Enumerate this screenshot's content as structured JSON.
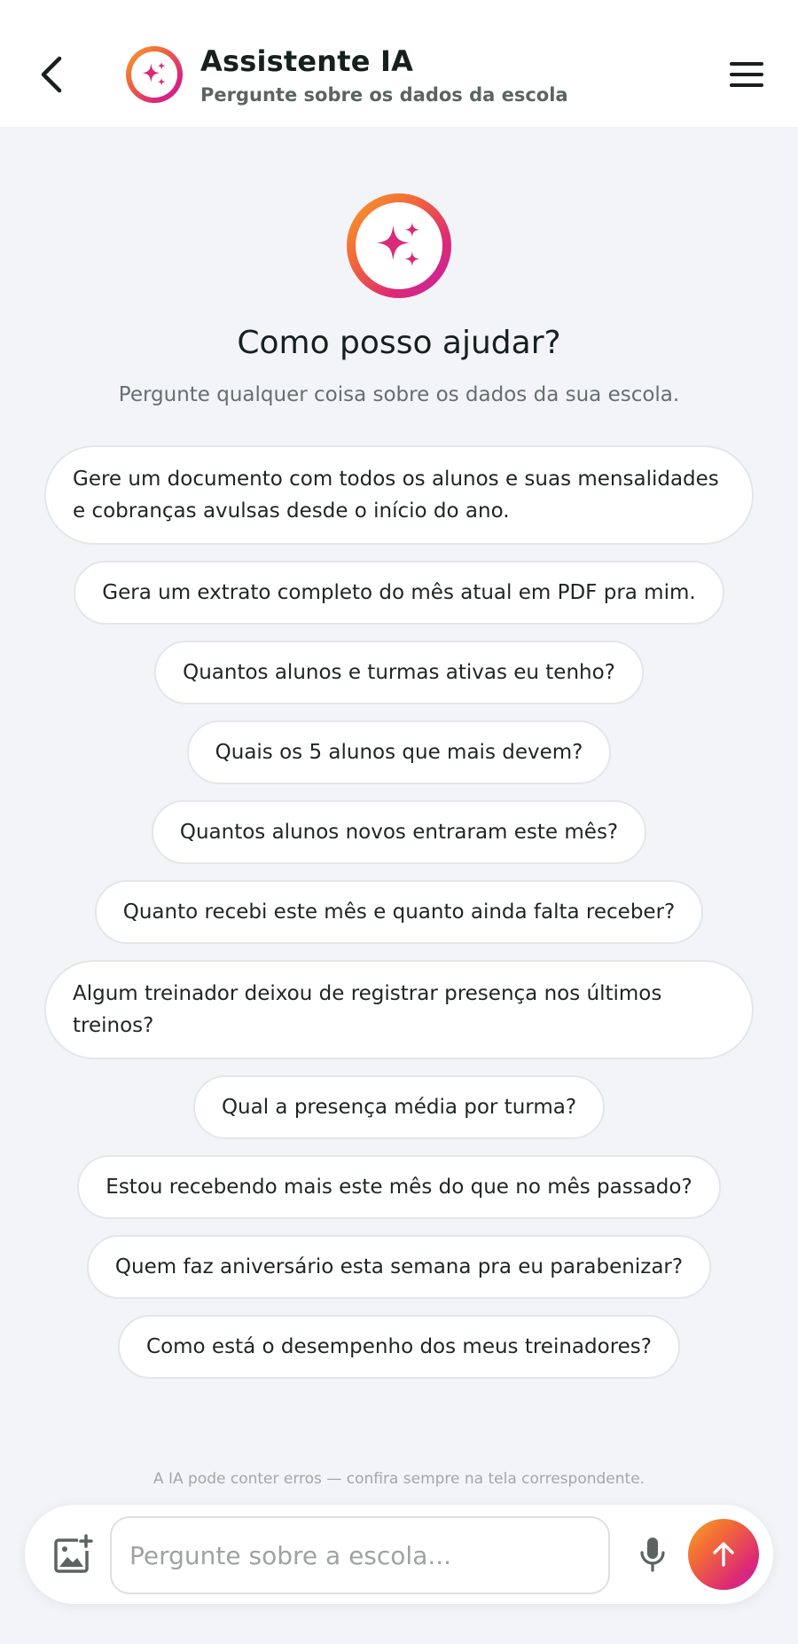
{
  "header": {
    "title": "Assistente IA",
    "subtitle": "Pergunte sobre os dados da escola",
    "back_icon": "chevron-left-icon",
    "menu_icon": "hamburger-menu-icon",
    "logo_icon": "sparkles-icon"
  },
  "hero": {
    "title": "Como posso ajudar?",
    "subtitle": "Pergunte qualquer coisa sobre os dados da sua escola."
  },
  "suggestions": [
    "Gere um documento com todos os alunos e suas mensalidades e cobranças avulsas desde o início do ano.",
    "Gera um extrato completo do mês atual em PDF pra mim.",
    "Quantos alunos e turmas ativas eu tenho?",
    "Quais os 5 alunos que mais devem?",
    "Quantos alunos novos entraram este mês?",
    "Quanto recebi este mês e quanto ainda falta receber?",
    "Algum treinador deixou de registrar presença nos últimos treinos?",
    "Qual a presença média por turma?",
    "Estou recebendo mais este mês do que no mês passado?",
    "Quem faz aniversário esta semana pra eu parabenizar?",
    "Como está o desempenho dos meus treinadores?"
  ],
  "disclaimer": "A IA pode conter erros — confira sempre na tela correspondente.",
  "composer": {
    "placeholder": "Pergunte sobre a escola...",
    "value": "",
    "attach_icon": "add-image-icon",
    "mic_icon": "microphone-icon",
    "send_icon": "arrow-up-icon"
  },
  "colors": {
    "background": "#f2f4f8",
    "gradient_start": "#f7a12b",
    "gradient_mid": "#dd2a74",
    "gradient_end": "#c020ad",
    "sparkle": "#d92a78"
  }
}
